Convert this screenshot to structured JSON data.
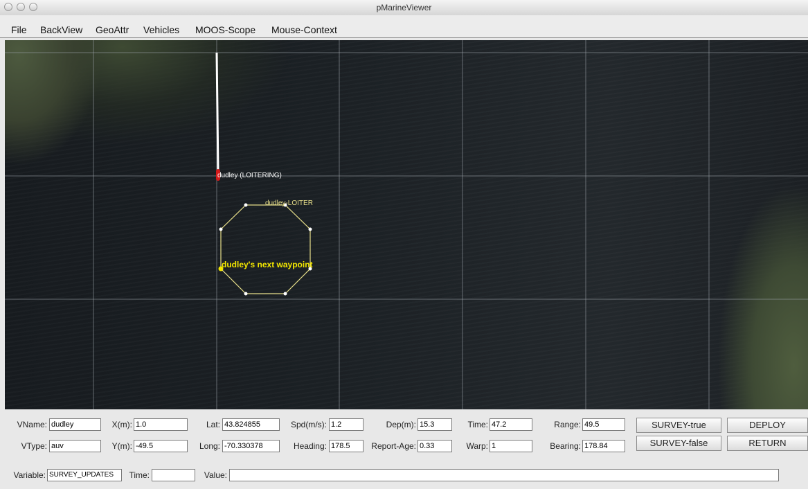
{
  "window": {
    "title": "pMarineViewer"
  },
  "menu": [
    "File",
    "BackView",
    "GeoAttr",
    "Vehicles",
    "MOOS-Scope",
    "Mouse-Context"
  ],
  "map": {
    "vehicle_label": "dudley (LOITERING)",
    "loiter_label": "dudley-LOITER",
    "waypoint_label": "dudley's next waypoint",
    "colors": {
      "polygon": "#e8df8a",
      "vehicle": "#d41a1a",
      "waypoint": "#f2e600",
      "trail": "#ffffff",
      "grid": "#9aa0a6"
    }
  },
  "panel": {
    "row1": {
      "vname_label": "VName:",
      "vname": "dudley",
      "x_label": "X(m):",
      "x": "1.0",
      "lat_label": "Lat:",
      "lat": "43.824855",
      "spd_label": "Spd(m/s):",
      "spd": "1.2",
      "dep_label": "Dep(m):",
      "dep": "15.3",
      "time_label": "Time:",
      "time": "47.2",
      "range_label": "Range:",
      "range": "49.5"
    },
    "row2": {
      "vtype_label": "VType:",
      "vtype": "auv",
      "y_label": "Y(m):",
      "y": "-49.5",
      "long_label": "Long:",
      "long": "-70.330378",
      "heading_label": "Heading:",
      "heading": "178.5",
      "report_age_label": "Report-Age:",
      "report_age": "0.33",
      "warp_label": "Warp:",
      "warp": "1",
      "bearing_label": "Bearing:",
      "bearing": "178.84"
    },
    "buttons": {
      "survey_true": "SURVEY-true",
      "survey_false": "SURVEY-false",
      "deploy": "DEPLOY",
      "return": "RETURN"
    },
    "scope": {
      "variable_label": "Variable:",
      "variable": "SURVEY_UPDATES",
      "time_label": "Time:",
      "time": "",
      "value_label": "Value:",
      "value": ""
    }
  }
}
